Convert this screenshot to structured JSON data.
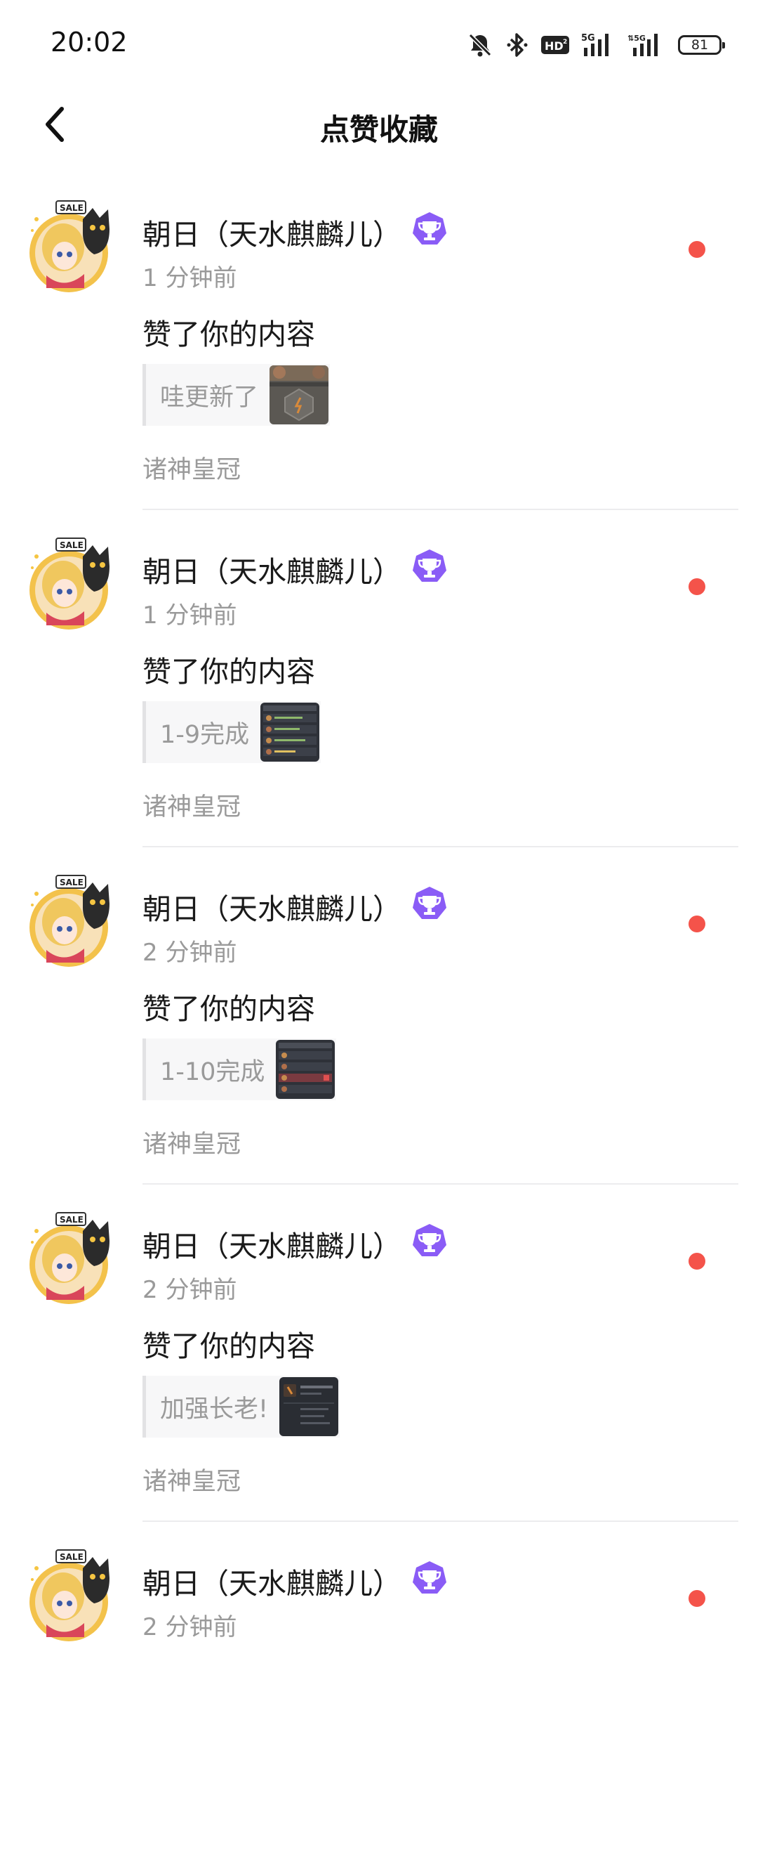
{
  "status_bar": {
    "time": "20:02",
    "battery": "81",
    "icons": [
      "mute-bell-icon",
      "bluetooth-icon",
      "hd-icon",
      "signal-5g-icon",
      "signal-5g-2-icon",
      "battery-icon"
    ]
  },
  "header": {
    "back_icon": "chevron-left-icon",
    "title": "点赞收藏"
  },
  "colors": {
    "unread_dot": "#f4534a",
    "badge_purple": "#8a5cf6",
    "secondary_text": "#9a9a9a"
  },
  "notifications": [
    {
      "user": "朝日（天水麒麟儿）",
      "badge_icon": "trophy-badge-icon",
      "time": "1 分钟前",
      "action": "赞了你的内容",
      "quote": "哇更新了",
      "game": "诸神皇冠"
    },
    {
      "user": "朝日（天水麒麟儿）",
      "badge_icon": "trophy-badge-icon",
      "time": "1 分钟前",
      "action": "赞了你的内容",
      "quote": "1-9完成",
      "game": "诸神皇冠"
    },
    {
      "user": "朝日（天水麒麟儿）",
      "badge_icon": "trophy-badge-icon",
      "time": "2 分钟前",
      "action": "赞了你的内容",
      "quote": "1-10完成",
      "game": "诸神皇冠"
    },
    {
      "user": "朝日（天水麒麟儿）",
      "badge_icon": "trophy-badge-icon",
      "time": "2 分钟前",
      "action": "赞了你的内容",
      "quote": "加强长老!",
      "game": "诸神皇冠"
    },
    {
      "user": "朝日（天水麒麟儿）",
      "badge_icon": "trophy-badge-icon",
      "time": "2 分钟前"
    }
  ]
}
